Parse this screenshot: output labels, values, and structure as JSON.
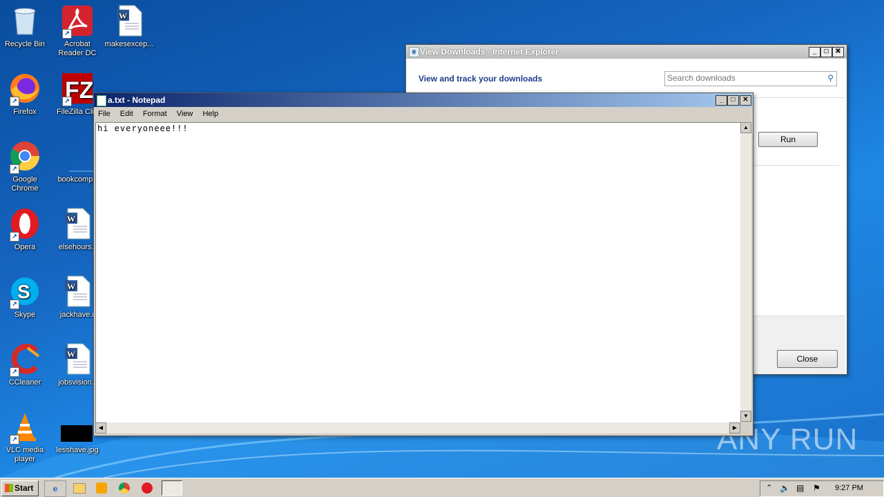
{
  "desktop": {
    "icons": [
      {
        "label": "Recycle Bin",
        "icon": "recycle-bin-icon"
      },
      {
        "label": "Acrobat Reader DC",
        "icon": "acrobat-icon"
      },
      {
        "label": "makesexcep...",
        "icon": "word-document-icon"
      },
      {
        "label": "Firefox",
        "icon": "firefox-icon"
      },
      {
        "label": "FileZilla Clie",
        "icon": "filezilla-icon"
      },
      {
        "label": "Google Chrome",
        "icon": "chrome-icon"
      },
      {
        "label": "bookcompa",
        "icon": "file-icon"
      },
      {
        "label": "Opera",
        "icon": "opera-icon"
      },
      {
        "label": "elsehours.r",
        "icon": "word-document-icon"
      },
      {
        "label": "Skype",
        "icon": "skype-icon"
      },
      {
        "label": "jackhave.r",
        "icon": "word-document-icon"
      },
      {
        "label": "CCleaner",
        "icon": "ccleaner-icon"
      },
      {
        "label": "jobsvision.r",
        "icon": "word-document-icon"
      },
      {
        "label": "VLC media player",
        "icon": "vlc-icon"
      },
      {
        "label": "lesshave.jpg",
        "icon": "image-file-icon"
      }
    ],
    "watermark": "ANY RUN"
  },
  "downloads_window": {
    "title": "View Downloads - Internet Explorer",
    "heading": "View and track your downloads",
    "search_placeholder": "Search downloads",
    "run_label": "Run",
    "close_label": "Close"
  },
  "notepad": {
    "title": "a.txt - Notepad",
    "menu": [
      "File",
      "Edit",
      "Format",
      "View",
      "Help"
    ],
    "content": "hi everyoneee!!!"
  },
  "taskbar": {
    "start_label": "Start",
    "clock": "9:27 PM"
  }
}
